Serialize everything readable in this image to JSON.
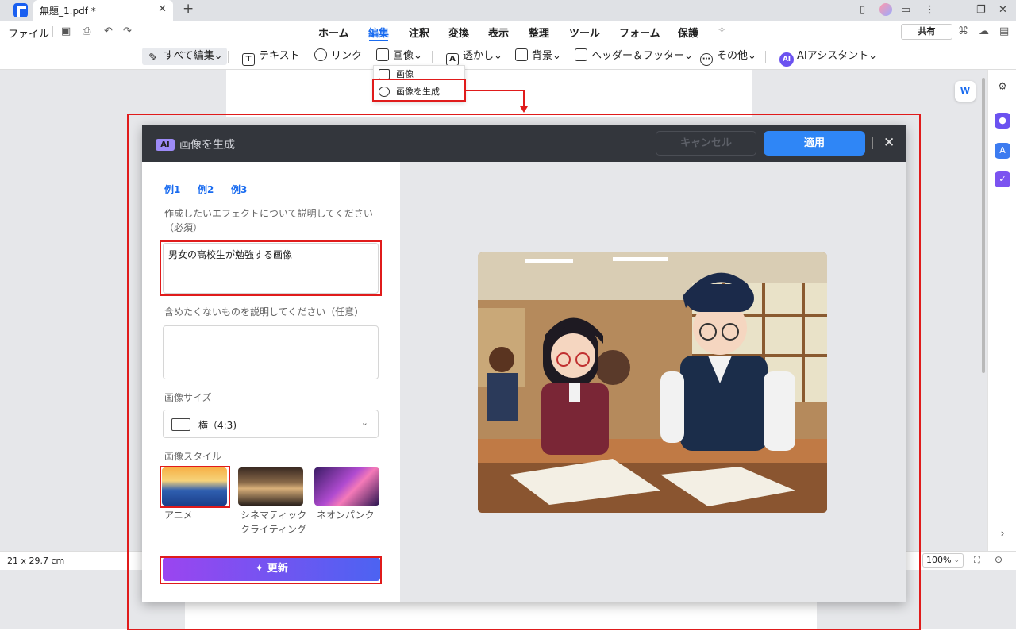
{
  "titlebar": {
    "tab_title": "無題_1.pdf *",
    "close": "✕",
    "new_tab": "+"
  },
  "menubar": {
    "file": "ファイル",
    "tabs": [
      "ホーム",
      "編集",
      "注釈",
      "変換",
      "表示",
      "整理",
      "ツール",
      "フォーム",
      "保護"
    ],
    "share": "共有"
  },
  "toolbar": {
    "edit_all": "すべて編集⌄",
    "text": "テキスト",
    "link": "リンク",
    "image": "画像⌄",
    "watermark": "透かし⌄",
    "background": "背景⌄",
    "header_footer": "ヘッダー＆フッター⌄",
    "other": "その他⌄",
    "ai_assistant": "AIアシスタント⌄"
  },
  "image_dropdown": {
    "items": [
      "画像",
      "画像を生成"
    ]
  },
  "dialog": {
    "ai_badge": "AI",
    "title": "画像を生成",
    "cancel": "キャンセル",
    "apply": "適用",
    "examples": [
      "例1",
      "例2",
      "例3"
    ],
    "prompt_label": "作成したいエフェクトについて説明してください（必須）",
    "prompt_value": "男女の高校生が勉強する画像",
    "negative_label": "含めたくないものを説明してください（任意）",
    "negative_value": "",
    "size_label": "画像サイズ",
    "size_value": "横（4:3)",
    "style_label": "画像スタイル",
    "styles": [
      "アニメ",
      "シネマティック クライティング",
      "ネオンパンク"
    ],
    "selected_style": "アニメ",
    "update": "更新"
  },
  "statusbar": {
    "page_size": "21 x 29.7 cm",
    "zoom": "100%"
  },
  "colors": {
    "accent": "#1a6cf0",
    "highlight": "#e01b1b",
    "dialog_header": "#33363c",
    "apply": "#2f86f6"
  }
}
